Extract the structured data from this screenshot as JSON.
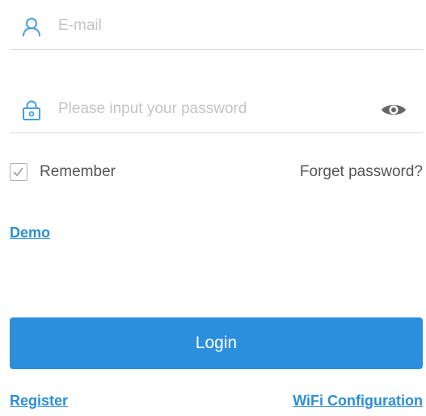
{
  "login_form": {
    "email": {
      "placeholder": "E-mail",
      "value": "",
      "icon": "user-icon"
    },
    "password": {
      "placeholder": "Please input your password",
      "value": "",
      "icon": "lock-icon",
      "toggle_icon": "eye-icon"
    },
    "remember": {
      "label": "Remember",
      "checked": true
    },
    "forget_password_label": "Forget password?",
    "demo_label": "Demo",
    "login_label": "Login",
    "register_label": "Register",
    "wifi_config_label": "WiFi Configuration"
  },
  "colors": {
    "accent": "#2c8fde",
    "link": "#2c8fd6",
    "icon": "#4a9ee0",
    "text": "#555555",
    "placeholder": "#c4c4c4",
    "divider": "#d9d9d9"
  }
}
